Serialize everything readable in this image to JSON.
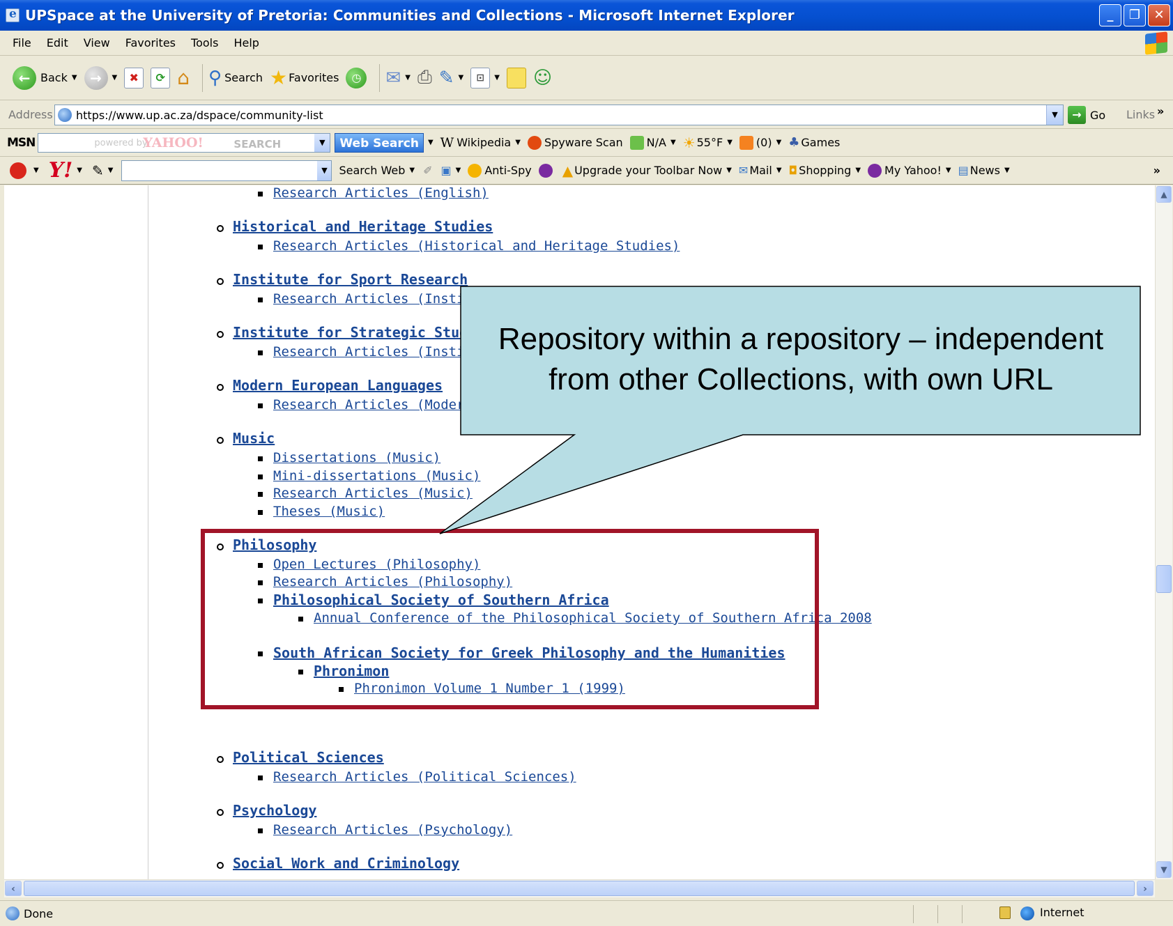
{
  "window": {
    "title": "UPSpace at the University of Pretoria: Communities and Collections - Microsoft Internet Explorer"
  },
  "menu": [
    "File",
    "Edit",
    "View",
    "Favorites",
    "Tools",
    "Help"
  ],
  "toolbar": {
    "back_label": "Back",
    "search_label": "Search",
    "favorites_label": "Favorites"
  },
  "address": {
    "label": "Address",
    "url": "https://www.up.ac.za/dspace/community-list",
    "go_label": "Go",
    "links_label": "Links"
  },
  "msn_bar": {
    "logo": "MSN",
    "powered_by": "powered by",
    "yahoo_watermark": "YAHOO!",
    "search_watermark": "SEARCH",
    "web_search_label": "Web Search",
    "wikipedia_label": "Wikipedia",
    "spyware_label": "Spyware Scan",
    "na_label": "N/A",
    "weather_label": "55°F",
    "rss_label": "(0)",
    "games_label": "Games"
  },
  "yahoo_bar": {
    "logo": "Y!",
    "search_web_label": "Search Web",
    "antispy_label": "Anti-Spy",
    "upgrade_label": "Upgrade your Toolbar Now",
    "mail_label": "Mail",
    "shopping_label": "Shopping",
    "myyahoo_label": "My Yahoo!",
    "news_label": "News"
  },
  "content": {
    "items": {
      "research_english": "Research Articles (English)",
      "historical": "Historical and Heritage Studies",
      "research_historical": "Research Articles (Historical and Heritage Studies)",
      "sport": "Institute for Sport Research",
      "research_sport": "Research Articles (Institute",
      "strategic": "Institute for Strategic Studies",
      "research_strategic": "Research Articles (Institute",
      "modern": "Modern European Languages",
      "research_modern": "Research Articles (Modern E",
      "music": "Music",
      "dissertations_music": "Dissertations (Music)",
      "minidiss_music": "Mini-dissertations (Music)",
      "research_music": "Research Articles (Music)",
      "theses_music": "Theses (Music)",
      "philosophy": "Philosophy",
      "open_lectures": "Open Lectures (Philosophy)",
      "research_philosophy": "Research Articles (Philosophy)",
      "phil_society": "Philosophical Society of Southern Africa",
      "annual_conf": "Annual Conference of the Philosophical Society of Southern Africa 2008",
      "greek_society": "South African Society for Greek Philosophy and the Humanities",
      "phronimon": "Phronimon",
      "phronimon_vol": "Phronimon Volume 1 Number 1 (1999)",
      "political": "Political Sciences",
      "research_political": "Research Articles (Political Sciences)",
      "psychology": "Psychology",
      "research_psychology": "Research Articles (Psychology)",
      "social_work": "Social Work and Criminology"
    },
    "callout": "Repository within a repository – independent from other Collections, with own URL",
    "highlight_color": "#a11428",
    "callout_fill": "#b7dde4",
    "link_color": "#1a4896"
  },
  "status": {
    "text": "Done",
    "zone": "Internet"
  }
}
